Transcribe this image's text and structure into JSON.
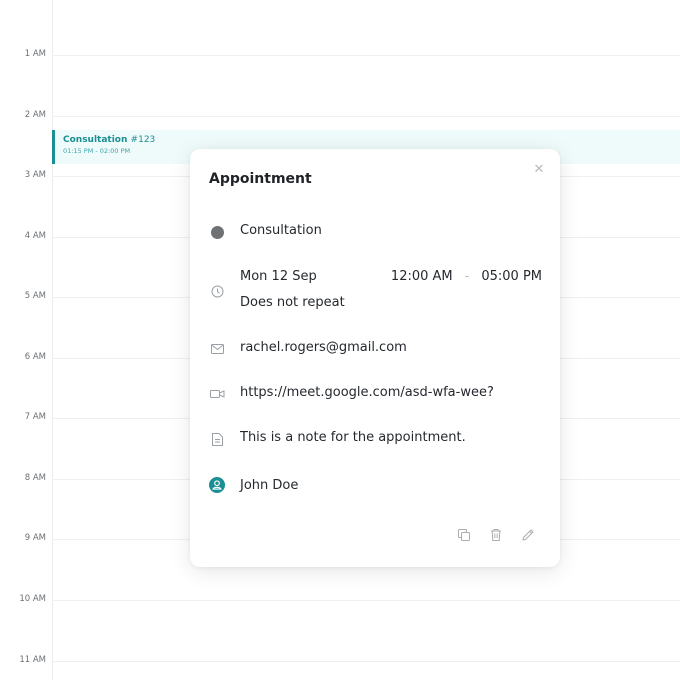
{
  "hours": [
    "1 AM",
    "2 AM",
    "3 AM",
    "4 AM",
    "5 AM",
    "6 AM",
    "7 AM",
    "8 AM",
    "9 AM",
    "10 AM",
    "11 AM"
  ],
  "event": {
    "title": "Consultation",
    "number": "#123",
    "time": "01:15 PM - 02:00 PM",
    "accent_color": "#1b8f94",
    "background_color": "#effafa"
  },
  "popover": {
    "title": "Appointment",
    "close_icon": "close-icon",
    "type": {
      "label": "Consultation",
      "dot_color": "#6f7275"
    },
    "date": "Mon 12 Sep",
    "start_time": "12:00 AM",
    "separator": "-",
    "end_time": "05:00 PM",
    "repeat": "Does not repeat",
    "email": "rachel.rogers@gmail.com",
    "meeting_link": "https://meet.google.com/asd-wfa-wee?",
    "note": "This is a note for the appointment.",
    "assignee": "John Doe",
    "icons": {
      "clock": "clock-icon",
      "mail": "mail-icon",
      "video": "video-icon",
      "note": "document-icon",
      "person": "user-icon",
      "copy": "copy-icon",
      "delete": "trash-icon",
      "edit": "pencil-icon"
    }
  }
}
